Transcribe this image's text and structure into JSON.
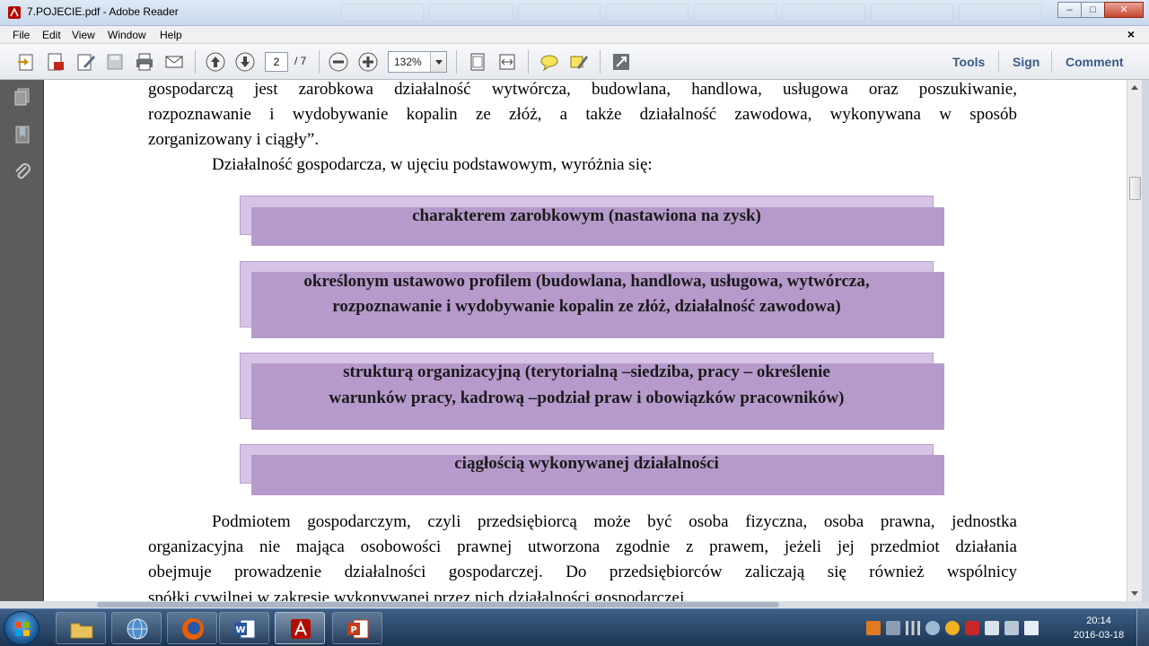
{
  "window": {
    "title": "7.POJECIE.pdf - Adobe Reader",
    "minimize": "–",
    "maximize": "□",
    "close": "✕"
  },
  "menu": [
    "File",
    "Edit",
    "View",
    "Window",
    "Help"
  ],
  "menu_close": "×",
  "toolbar": {
    "page_current": "2",
    "page_total": "/ 7",
    "zoom": "132%",
    "tools": "Tools",
    "sign": "Sign",
    "comment": "Comment"
  },
  "document": {
    "para1_lines": [
      "gospodarczą jest zarobkowa działalność wytwórcza, budowlana, handlowa, usługowa oraz poszukiwanie,",
      "rozpoznawanie i wydobywanie kopalin ze złóż, a także działalność zawodowa, wykonywana w sposób"
    ],
    "para1_last": "zorganizowany i ciągły”.",
    "intro": "Działalność gospodarcza, w ujęciu podstawowym, wyróżnia się:",
    "boxes": [
      {
        "line1": "charakterem zarobkowym (nastawiona na zysk)",
        "line2": ""
      },
      {
        "line1": "określonym ustawowo profilem (budowlana, handlowa, usługowa, wytwórcza,",
        "line2": "rozpoznawanie i wydobywanie kopalin ze złóż, działalność zawodowa)"
      },
      {
        "line1": "strukturą organizacyjną (terytorialną –siedziba, pracy – określenie",
        "line2": "warunków pracy, kadrową –podział praw i obowiązków pracowników)"
      },
      {
        "line1": "ciągłością wykonywanej działalności",
        "line2": ""
      }
    ],
    "para2_lines": [
      "Podmiotem gospodarczym, czyli przedsiębiorcą może być osoba fizyczna, osoba prawna, jednostka",
      "organizacyjna nie mająca osobowości prawnej utworzona zgodnie z prawem, jeżeli jej przedmiot działania",
      "obejmuje prowadzenie działalności gospodarczej. Do przedsiębiorców zaliczają się również wspólnicy"
    ],
    "para2_last": "spółki cywilnej w zakresie wykonywanej przez nich działalności gospodarczej."
  },
  "clock": {
    "time": "20:14",
    "date": "2016-03-18"
  },
  "colors": {
    "box_back": "#d6c3e6",
    "box_front": "#b69acb",
    "accent_link": "#3a5b86"
  }
}
